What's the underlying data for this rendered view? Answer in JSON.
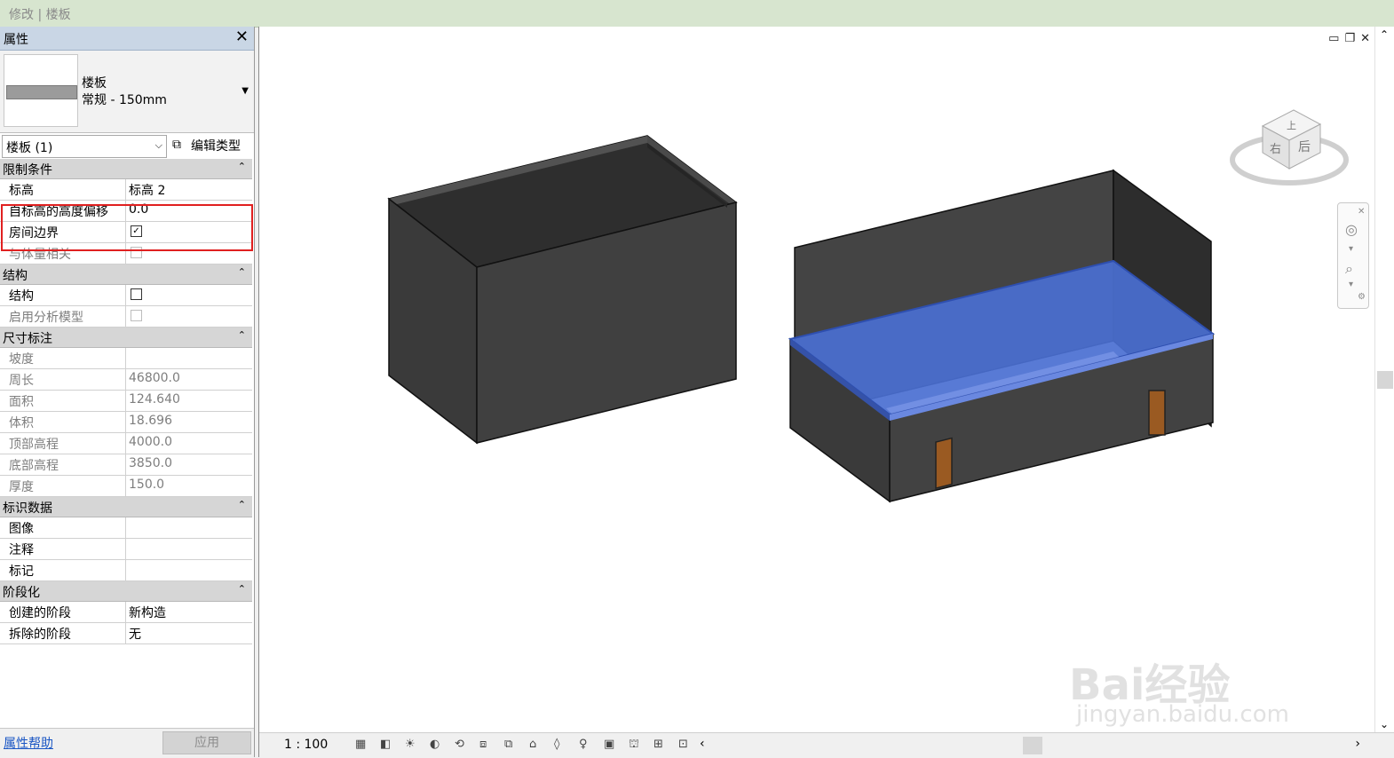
{
  "ribbon": {
    "context": "修改 | 楼板"
  },
  "properties": {
    "title": "属性",
    "close": "✕",
    "type": {
      "family": "楼板",
      "name": "常规 - 150mm"
    },
    "instance_selector": "楼板 (1)",
    "edit_type": "编辑类型",
    "groups": [
      {
        "label": "限制条件",
        "rows": [
          {
            "key": "标高",
            "value": "标高 2"
          },
          {
            "key": "自标高的高度偏移",
            "value": "0.0"
          },
          {
            "key": "房间边界",
            "checkbox": true,
            "checked": true
          },
          {
            "key": "与体量相关",
            "checkbox": true,
            "checked": false,
            "disabled": true
          }
        ]
      },
      {
        "label": "结构",
        "rows": [
          {
            "key": "结构",
            "checkbox": true,
            "checked": false
          },
          {
            "key": "启用分析模型",
            "checkbox": true,
            "checked": false,
            "disabled": true
          }
        ]
      },
      {
        "label": "尺寸标注",
        "rows": [
          {
            "key": "坡度",
            "value": "",
            "disabled": true
          },
          {
            "key": "周长",
            "value": "46800.0",
            "disabled": true
          },
          {
            "key": "面积",
            "value": "124.640",
            "disabled": true
          },
          {
            "key": "体积",
            "value": "18.696",
            "disabled": true
          },
          {
            "key": "顶部高程",
            "value": "4000.0",
            "disabled": true
          },
          {
            "key": "底部高程",
            "value": "3850.0",
            "disabled": true
          },
          {
            "key": "厚度",
            "value": "150.0",
            "disabled": true
          }
        ]
      },
      {
        "label": "标识数据",
        "rows": [
          {
            "key": "图像",
            "value": ""
          },
          {
            "key": "注释",
            "value": ""
          },
          {
            "key": "标记",
            "value": ""
          }
        ]
      },
      {
        "label": "阶段化",
        "rows": [
          {
            "key": "创建的阶段",
            "value": "新构造"
          },
          {
            "key": "拆除的阶段",
            "value": "无"
          }
        ]
      }
    ],
    "help_link": "属性帮助",
    "apply_button": "应用"
  },
  "view": {
    "scale": "1 : 100",
    "viewcube_faces": {
      "top": "上",
      "right": "右",
      "back": "后"
    },
    "watermark": {
      "brand": "Bai经验",
      "url": "jingyan.baidu.com"
    },
    "colors": {
      "selection": "#4a6fd1",
      "walls": "#3f3f3f",
      "door": "#9a5a22"
    }
  }
}
